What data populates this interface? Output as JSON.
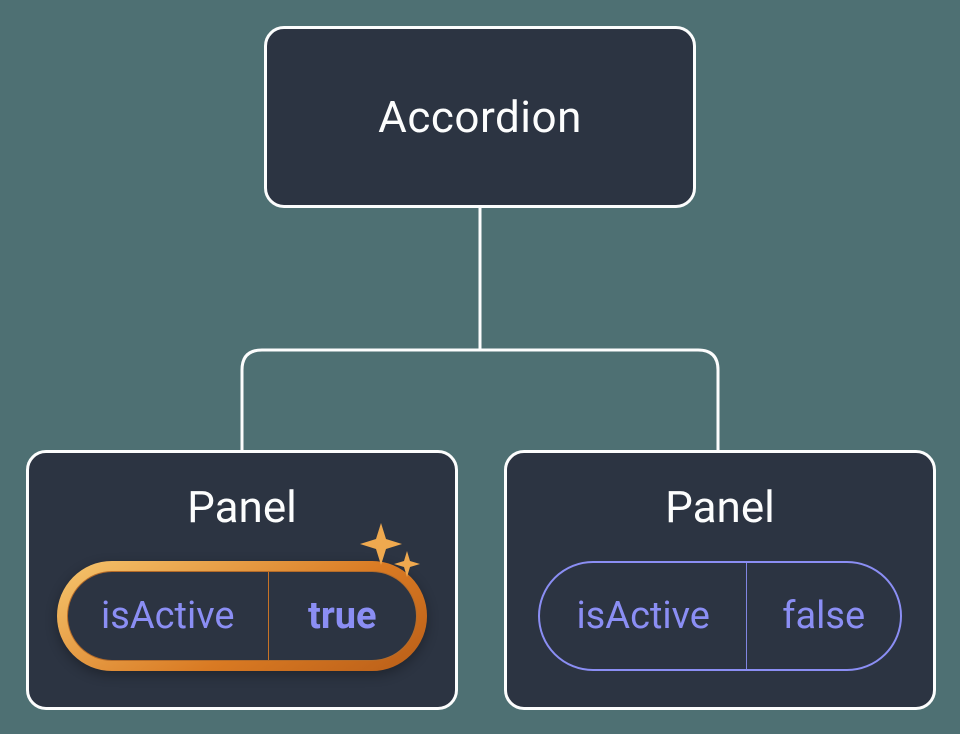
{
  "root": {
    "label": "Accordion"
  },
  "children": [
    {
      "label": "Panel",
      "state": {
        "key": "isActive",
        "value": "true"
      },
      "highlighted": true
    },
    {
      "label": "Panel",
      "state": {
        "key": "isActive",
        "value": "false"
      },
      "highlighted": false
    }
  ],
  "colors": {
    "background": "#4e7073",
    "node_fill": "#2c3442",
    "node_border": "#fcfdfd",
    "text": "#fcfdfd",
    "prop_text": "#8b8ef4",
    "highlight_gradient_start": "#f6c66e",
    "highlight_gradient_end": "#b95e18",
    "sparkle": "#efa94f"
  }
}
